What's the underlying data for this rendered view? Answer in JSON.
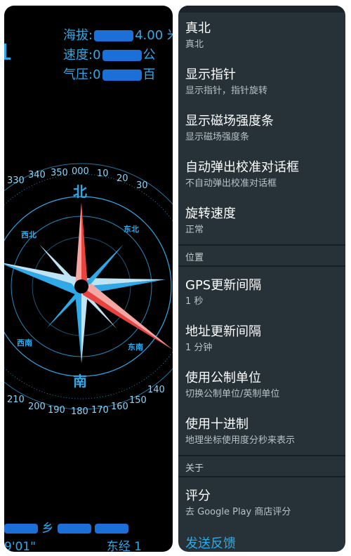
{
  "compass_app": {
    "altitude": {
      "label": "海拔:",
      "prefix": "",
      "value": "4.00",
      "unit": "米"
    },
    "speed": {
      "label": "速度:",
      "prefix": "0",
      "unit": "公"
    },
    "pressure": {
      "label": "气压:",
      "prefix": "0",
      "unit": "百"
    },
    "dial": {
      "north_char": "北",
      "south_char": "南",
      "northeast_label": "东北",
      "northwest_label": "西北",
      "southeast_label": "东南",
      "southwest_label": "西南",
      "top_ticks": [
        "330",
        "340",
        "350",
        "000",
        "10",
        "20",
        "30"
      ],
      "bottom_ticks": [
        "210",
        "200",
        "190",
        "180",
        "170",
        "160",
        "150",
        "140"
      ]
    },
    "location": {
      "address_visible": "乡",
      "latitude_fragment": "9'01\"",
      "longitude_label": "东经 1"
    },
    "colors": {
      "accent": "#2fa9e8",
      "needle_red": "#e8433f",
      "needle_light": "#dbe9ef"
    }
  },
  "settings": {
    "items": [
      {
        "title": "真北",
        "summary": "真北"
      },
      {
        "title": "显示指针",
        "summary": "显示指针，指针旋转"
      },
      {
        "title": "显示磁场强度条",
        "summary": "显示磁场强度条"
      },
      {
        "title": "自动弹出校准对话框",
        "summary": "不自动弹出校准对话框"
      },
      {
        "title": "旋转速度",
        "summary": "正常"
      }
    ],
    "section_location": "位置",
    "location_items": [
      {
        "title": "GPS更新间隔",
        "summary": "1 秒"
      },
      {
        "title": "地址更新间隔",
        "summary": "1 分钟"
      },
      {
        "title": "使用公制单位",
        "summary": "切换公制单位/英制单位"
      },
      {
        "title": "使用十进制",
        "summary": "地理坐标使用度分秒来表示"
      }
    ],
    "section_about": "关于",
    "about_items": [
      {
        "title": "评分",
        "summary": "去 Google Play 商店评分"
      }
    ],
    "feedback_label": "发送反馈"
  }
}
